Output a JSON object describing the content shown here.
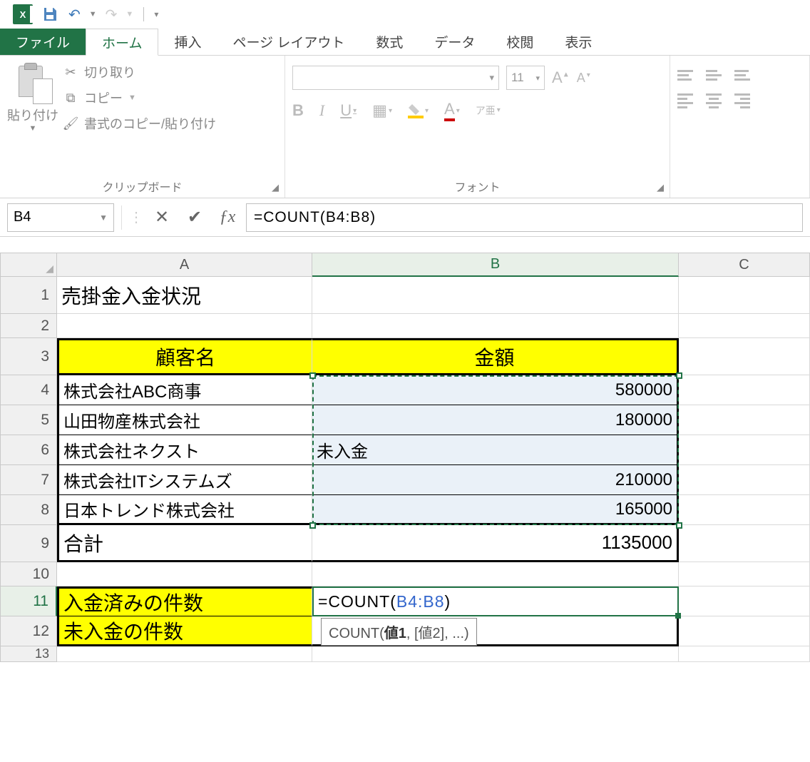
{
  "qat": {
    "undo": "↶",
    "redo": "↷"
  },
  "tabs": {
    "file": "ファイル",
    "home": "ホーム",
    "insert": "挿入",
    "page_layout": "ページ レイアウト",
    "formulas": "数式",
    "data": "データ",
    "review": "校閲",
    "view": "表示"
  },
  "ribbon": {
    "clipboard": {
      "paste": "貼り付け",
      "cut": "切り取り",
      "copy": "コピー",
      "format_painter": "書式のコピー/貼り付け",
      "label": "クリップボード"
    },
    "font": {
      "size": "11",
      "label": "フォント",
      "bold": "B",
      "italic": "I",
      "underline": "U",
      "ruby": "ア亜"
    }
  },
  "namebox": "B4",
  "formula": "=COUNT(B4:B8)",
  "cols": {
    "A": "A",
    "B": "B",
    "C": "C"
  },
  "rows": [
    "1",
    "2",
    "3",
    "4",
    "5",
    "6",
    "7",
    "8",
    "9",
    "10",
    "11",
    "12",
    "13"
  ],
  "sheet": {
    "title": "売掛金入金状況",
    "header_customer": "顧客名",
    "header_amount": "金額",
    "customers": [
      "株式会社ABC商事",
      "山田物産株式会社",
      "株式会社ネクスト",
      "株式会社ITシステムズ",
      "日本トレンド株式会社"
    ],
    "amounts": [
      "580000",
      "180000",
      "未入金",
      "210000",
      "165000"
    ],
    "total_label": "合計",
    "total_amount": "1135000",
    "paid_label": "入金済みの件数",
    "unpaid_label": "未入金の件数",
    "editing_formula_prefix": "=COUNT(",
    "editing_formula_ref": "B4:B8",
    "editing_formula_suffix": ")"
  },
  "tooltip": {
    "text_prefix": "COUNT(",
    "arg1": "値1",
    "rest": ", [値2], ...)"
  }
}
